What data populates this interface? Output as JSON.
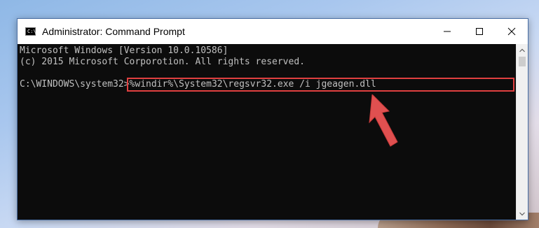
{
  "window": {
    "title": "Administrator: Command Prompt",
    "app_icon_text": "C:\\"
  },
  "controls": {
    "minimize": "minimize",
    "maximize": "maximize",
    "close": "close"
  },
  "console": {
    "line1": "Microsoft Windows [Version 10.0.10586]",
    "line2": "(c) 2015 Microsoft Corporotion. All rights reserved.",
    "prompt": "C:\\WINDOWS\\system32>",
    "command": "%windir%\\System32\\regsvr32.exe /i jgeagen.dll"
  },
  "colors": {
    "console_bg": "#0c0c0c",
    "console_text": "#c0c0c0",
    "highlight": "#e04040",
    "arrow": "#e05050"
  },
  "icons": {
    "minimize": "minimize-icon",
    "maximize": "maximize-icon",
    "close": "close-icon",
    "scroll_up": "scroll-up-icon",
    "scroll_down": "scroll-down-icon",
    "arrow": "red-arrow-icon"
  }
}
